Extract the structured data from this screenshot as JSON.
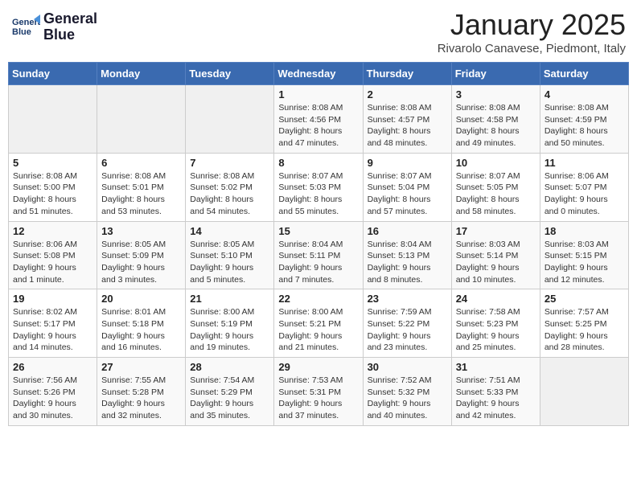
{
  "header": {
    "logo_line1": "General",
    "logo_line2": "Blue",
    "title": "January 2025",
    "subtitle": "Rivarolo Canavese, Piedmont, Italy"
  },
  "weekdays": [
    "Sunday",
    "Monday",
    "Tuesday",
    "Wednesday",
    "Thursday",
    "Friday",
    "Saturday"
  ],
  "weeks": [
    [
      {
        "day": "",
        "info": ""
      },
      {
        "day": "",
        "info": ""
      },
      {
        "day": "",
        "info": ""
      },
      {
        "day": "1",
        "info": "Sunrise: 8:08 AM\nSunset: 4:56 PM\nDaylight: 8 hours\nand 47 minutes."
      },
      {
        "day": "2",
        "info": "Sunrise: 8:08 AM\nSunset: 4:57 PM\nDaylight: 8 hours\nand 48 minutes."
      },
      {
        "day": "3",
        "info": "Sunrise: 8:08 AM\nSunset: 4:58 PM\nDaylight: 8 hours\nand 49 minutes."
      },
      {
        "day": "4",
        "info": "Sunrise: 8:08 AM\nSunset: 4:59 PM\nDaylight: 8 hours\nand 50 minutes."
      }
    ],
    [
      {
        "day": "5",
        "info": "Sunrise: 8:08 AM\nSunset: 5:00 PM\nDaylight: 8 hours\nand 51 minutes."
      },
      {
        "day": "6",
        "info": "Sunrise: 8:08 AM\nSunset: 5:01 PM\nDaylight: 8 hours\nand 53 minutes."
      },
      {
        "day": "7",
        "info": "Sunrise: 8:08 AM\nSunset: 5:02 PM\nDaylight: 8 hours\nand 54 minutes."
      },
      {
        "day": "8",
        "info": "Sunrise: 8:07 AM\nSunset: 5:03 PM\nDaylight: 8 hours\nand 55 minutes."
      },
      {
        "day": "9",
        "info": "Sunrise: 8:07 AM\nSunset: 5:04 PM\nDaylight: 8 hours\nand 57 minutes."
      },
      {
        "day": "10",
        "info": "Sunrise: 8:07 AM\nSunset: 5:05 PM\nDaylight: 8 hours\nand 58 minutes."
      },
      {
        "day": "11",
        "info": "Sunrise: 8:06 AM\nSunset: 5:07 PM\nDaylight: 9 hours\nand 0 minutes."
      }
    ],
    [
      {
        "day": "12",
        "info": "Sunrise: 8:06 AM\nSunset: 5:08 PM\nDaylight: 9 hours\nand 1 minute."
      },
      {
        "day": "13",
        "info": "Sunrise: 8:05 AM\nSunset: 5:09 PM\nDaylight: 9 hours\nand 3 minutes."
      },
      {
        "day": "14",
        "info": "Sunrise: 8:05 AM\nSunset: 5:10 PM\nDaylight: 9 hours\nand 5 minutes."
      },
      {
        "day": "15",
        "info": "Sunrise: 8:04 AM\nSunset: 5:11 PM\nDaylight: 9 hours\nand 7 minutes."
      },
      {
        "day": "16",
        "info": "Sunrise: 8:04 AM\nSunset: 5:13 PM\nDaylight: 9 hours\nand 8 minutes."
      },
      {
        "day": "17",
        "info": "Sunrise: 8:03 AM\nSunset: 5:14 PM\nDaylight: 9 hours\nand 10 minutes."
      },
      {
        "day": "18",
        "info": "Sunrise: 8:03 AM\nSunset: 5:15 PM\nDaylight: 9 hours\nand 12 minutes."
      }
    ],
    [
      {
        "day": "19",
        "info": "Sunrise: 8:02 AM\nSunset: 5:17 PM\nDaylight: 9 hours\nand 14 minutes."
      },
      {
        "day": "20",
        "info": "Sunrise: 8:01 AM\nSunset: 5:18 PM\nDaylight: 9 hours\nand 16 minutes."
      },
      {
        "day": "21",
        "info": "Sunrise: 8:00 AM\nSunset: 5:19 PM\nDaylight: 9 hours\nand 19 minutes."
      },
      {
        "day": "22",
        "info": "Sunrise: 8:00 AM\nSunset: 5:21 PM\nDaylight: 9 hours\nand 21 minutes."
      },
      {
        "day": "23",
        "info": "Sunrise: 7:59 AM\nSunset: 5:22 PM\nDaylight: 9 hours\nand 23 minutes."
      },
      {
        "day": "24",
        "info": "Sunrise: 7:58 AM\nSunset: 5:23 PM\nDaylight: 9 hours\nand 25 minutes."
      },
      {
        "day": "25",
        "info": "Sunrise: 7:57 AM\nSunset: 5:25 PM\nDaylight: 9 hours\nand 28 minutes."
      }
    ],
    [
      {
        "day": "26",
        "info": "Sunrise: 7:56 AM\nSunset: 5:26 PM\nDaylight: 9 hours\nand 30 minutes."
      },
      {
        "day": "27",
        "info": "Sunrise: 7:55 AM\nSunset: 5:28 PM\nDaylight: 9 hours\nand 32 minutes."
      },
      {
        "day": "28",
        "info": "Sunrise: 7:54 AM\nSunset: 5:29 PM\nDaylight: 9 hours\nand 35 minutes."
      },
      {
        "day": "29",
        "info": "Sunrise: 7:53 AM\nSunset: 5:31 PM\nDaylight: 9 hours\nand 37 minutes."
      },
      {
        "day": "30",
        "info": "Sunrise: 7:52 AM\nSunset: 5:32 PM\nDaylight: 9 hours\nand 40 minutes."
      },
      {
        "day": "31",
        "info": "Sunrise: 7:51 AM\nSunset: 5:33 PM\nDaylight: 9 hours\nand 42 minutes."
      },
      {
        "day": "",
        "info": ""
      }
    ]
  ]
}
